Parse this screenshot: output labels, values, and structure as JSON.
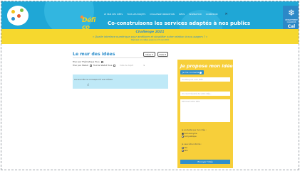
{
  "header": {
    "nav": [
      "Le mur des idées",
      "Tous les projets",
      "Challenge innovation",
      "Infos",
      "Inspiration",
      "Connexion"
    ],
    "close_icon": "close-icon",
    "brand_word": "Défi co",
    "title": "Co-construisons les services adaptés à nos publics",
    "right_logo_caption": "DÉPARTEMENT CALVADOS",
    "right_logo_word": "Cal"
  },
  "banner": {
    "title": "Challenge 2021",
    "question": "« Quelle interface numérique pour améliorer et simplifier notre relation à nos usagers ? »",
    "dates": "Déposez vos idées jusqu'au 15 mai 2021"
  },
  "wall": {
    "title": "Le mur des idées",
    "btn_views": "Idées",
    "btn_sort": "Date",
    "filter_theme": "Trier par Thématique Tous",
    "filter_status": "Trier par Statut",
    "filter_status_value": "Tout le Statut Tous",
    "filter_date_placeholder": "Date de dépôt",
    "filter_x": "×",
    "empty_message": "Aucune idée ne correspond à vos critères"
  },
  "panel": {
    "title": "Je propose mon idée !",
    "connect_label": "Je me connecte",
    "field_title_placeholder": "Un titre pour mon idée",
    "field_summary_placeholder": "Un court résumé de votre idée...",
    "field_desc_placeholder": "Décrivez votre idée",
    "q1_label": "Je souhaite que mon idée :",
    "q1_opt1": "Soit anonyme",
    "q1_opt2": "Soit publique",
    "q2_label": "Je veux être informé :",
    "q2_opt1": "Oui",
    "q2_opt2": "Non",
    "send_label": "Envoyer l'idée"
  },
  "colors": {
    "header_blue": "#1fa7d6",
    "banner_yellow": "#f6d82e",
    "panel_yellow": "#f7cf3a",
    "accent_blue": "#2f8fcc",
    "empty_box": "#bfe9f7"
  }
}
